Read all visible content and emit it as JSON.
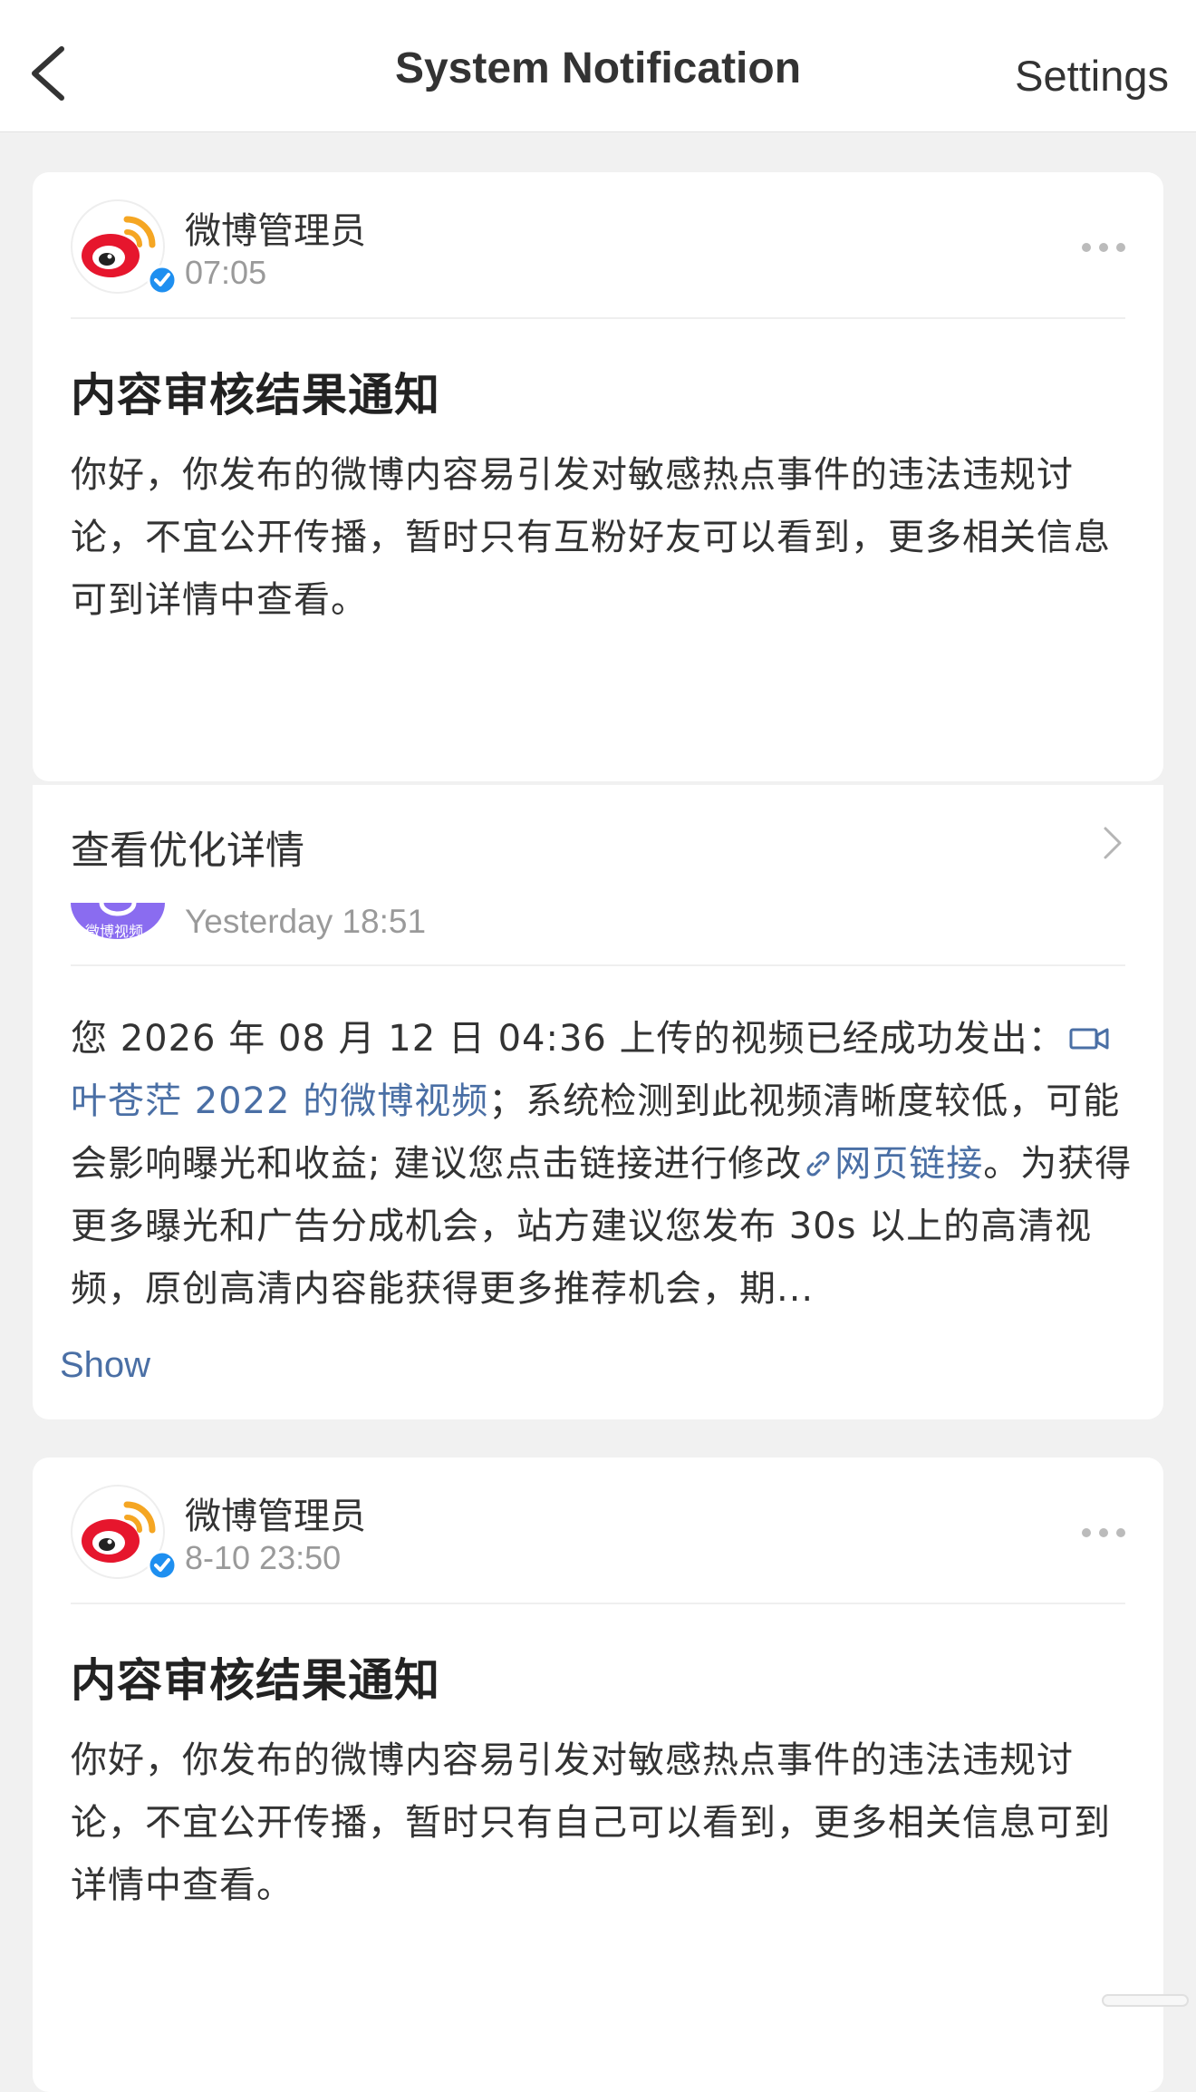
{
  "nav": {
    "title": "System Notification",
    "settings_label": "Settings"
  },
  "card1": {
    "sender": "微博管理员",
    "time": "07:05",
    "title": "内容审核结果通知",
    "body": "你好，你发布的微博内容易引发对敏感热点事件的违法违规讨论，不宜公开传播，暂时只有互粉好友可以看到，更多相关信息可到详情中查看。",
    "detail_label": "查看优化详情"
  },
  "card2": {
    "avatar_text": "微博视频",
    "time": "Yesterday 18:51",
    "body": {
      "part1": "您 2026 年 08 月 12 日 04:36 上传的视频已经成功发出：",
      "video_link": "叶苍茫 2022 的微博视频",
      "part2": "；系统检测到此视频清晰度较低，可能会影响曝光和收益; 建议您点击链接进行修改",
      "web_link": "网页链接",
      "part3": "。为获得更多曝光和广告分成机会，站方建议您发布 30s 以上的高清视频，原创高清内容能获得更多推荐机会，期..."
    },
    "show_label": "Show"
  },
  "card3": {
    "sender": "微博管理员",
    "time": "8-10 23:50",
    "title": "内容审核结果通知",
    "body": "你好，你发布的微博内容易引发对敏感热点事件的违法违规讨论，不宜公开传播，暂时只有自己可以看到，更多相关信息可到详情中查看。"
  },
  "colors": {
    "link": "#4a6fa5",
    "weibo_red": "#e6162d",
    "weibo_orange": "#f5a623",
    "verify_blue": "#1e8ff0",
    "video_purple": "#8a6cf0"
  },
  "icons": [
    "back-chevron-icon",
    "weibo-logo-icon",
    "verified-badge-icon",
    "more-dots-icon",
    "chevron-right-icon",
    "video-camera-icon",
    "link-icon",
    "weibo-video-logo-icon"
  ]
}
